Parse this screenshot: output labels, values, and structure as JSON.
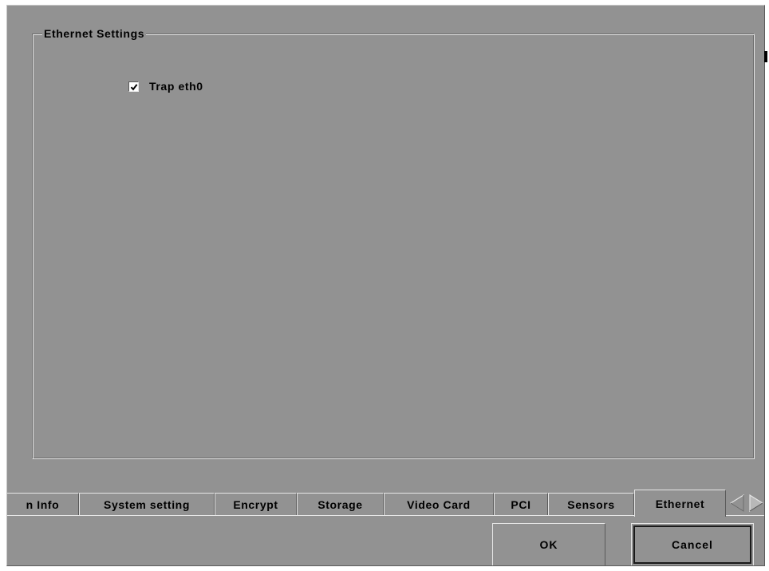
{
  "dialog": {
    "group_title": "Ethernet Settings",
    "trap_checkbox": {
      "label": "Trap eth0",
      "checked": true
    },
    "tabs": [
      {
        "label": "n Info",
        "active": false
      },
      {
        "label": "System setting",
        "active": false
      },
      {
        "label": "Encrypt",
        "active": false
      },
      {
        "label": "Storage",
        "active": false
      },
      {
        "label": "Video Card",
        "active": false
      },
      {
        "label": "PCI",
        "active": false
      },
      {
        "label": "Sensors",
        "active": false
      },
      {
        "label": "Ethernet",
        "active": true
      }
    ],
    "tab_scroll": {
      "left_icon": "arrow-left-icon",
      "right_icon": "arrow-right-icon"
    },
    "ok_label": "OK",
    "cancel_label": "Cancel"
  },
  "colors": {
    "background": "#929292",
    "highlight": "#e6e6e6",
    "shadow": "#5a5a5a",
    "text": "#000000"
  }
}
